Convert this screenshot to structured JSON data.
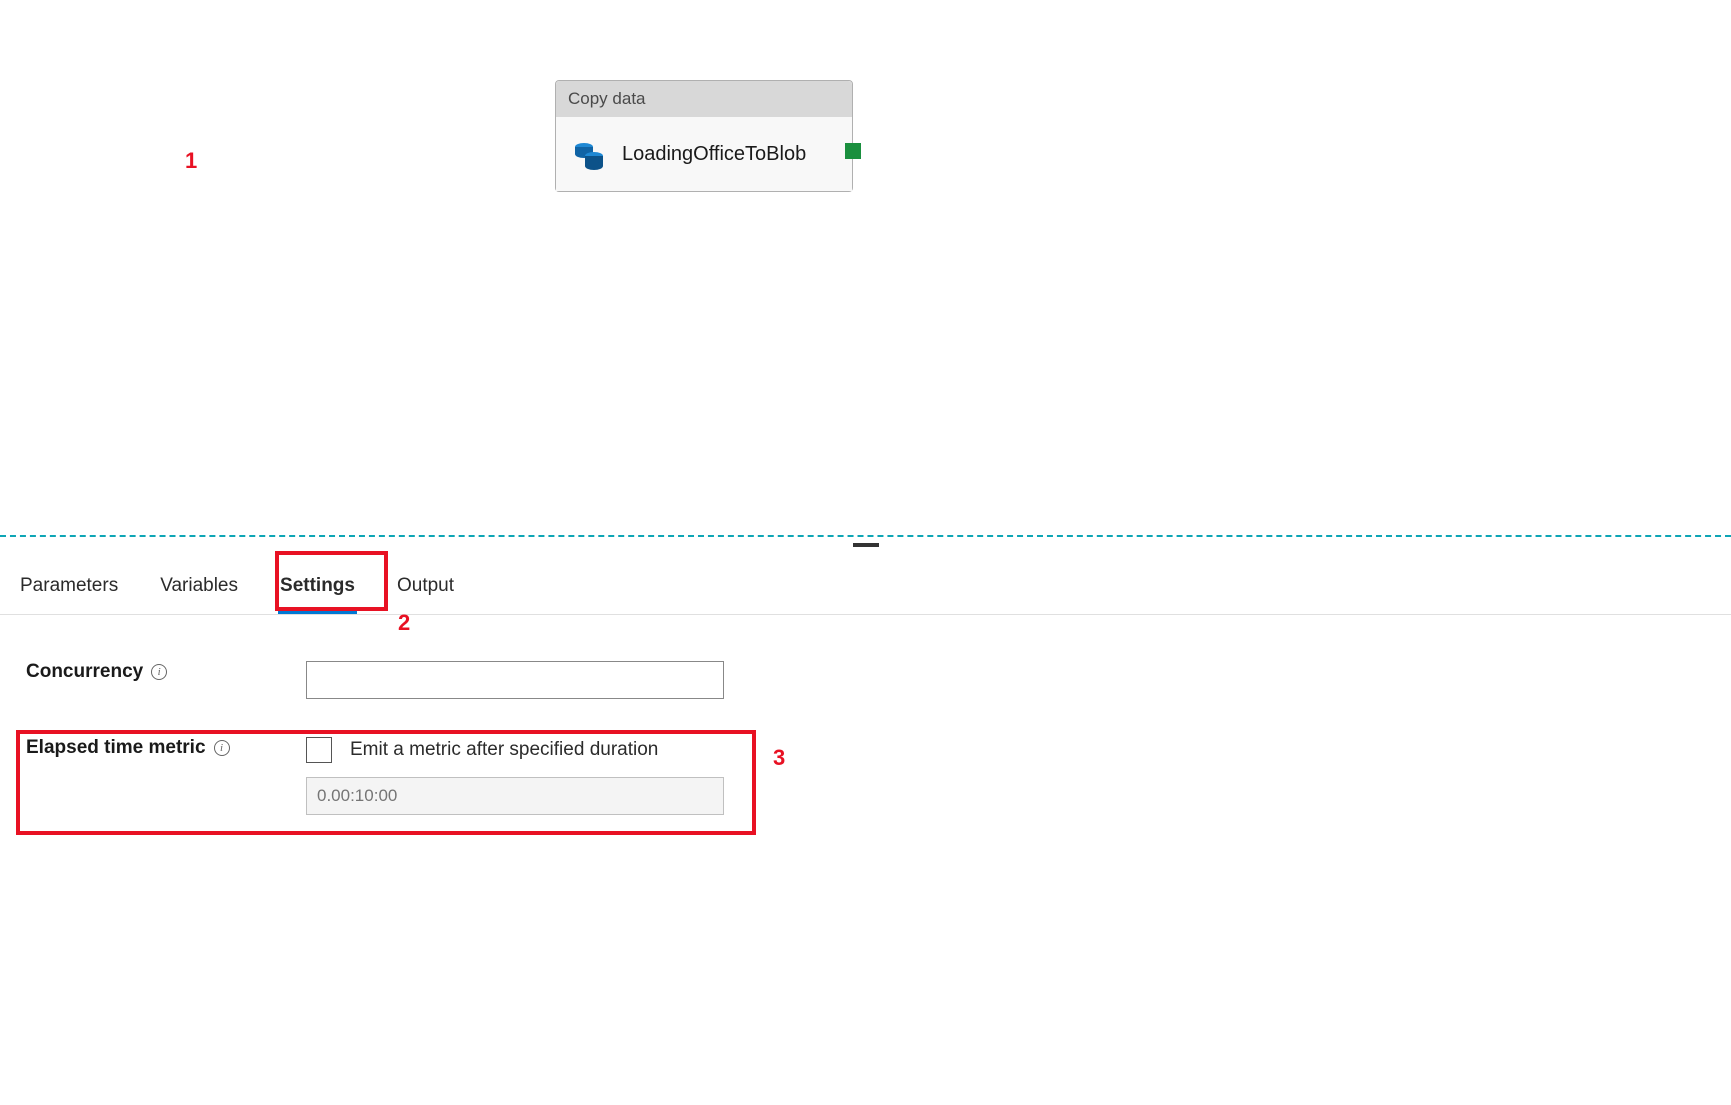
{
  "callouts": {
    "one": "1",
    "two": "2",
    "three": "3"
  },
  "activity": {
    "header": "Copy data",
    "name": "LoadingOfficeToBlob"
  },
  "tabs": {
    "parameters": "Parameters",
    "variables": "Variables",
    "settings": "Settings",
    "output": "Output"
  },
  "settings": {
    "concurrency_label": "Concurrency",
    "concurrency_value": "",
    "elapsed_label": "Elapsed time metric",
    "elapsed_checkbox_label": "Emit a metric after specified duration",
    "elapsed_placeholder": "0.00:10:00"
  }
}
